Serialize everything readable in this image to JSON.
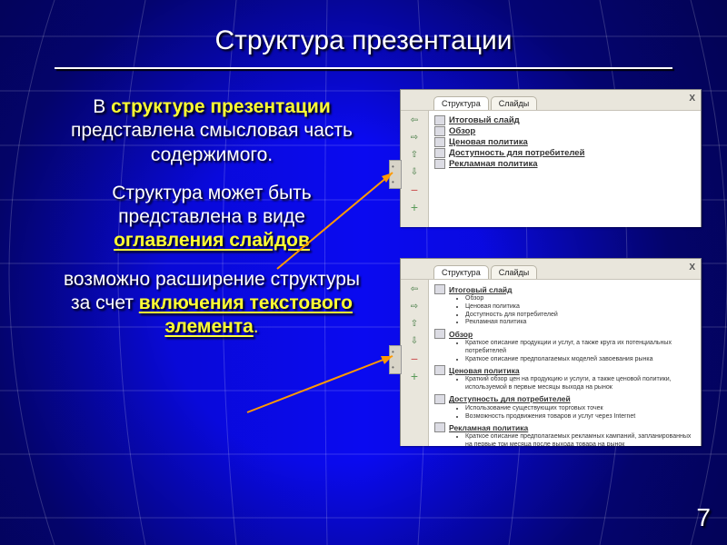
{
  "title": "Структура презентации",
  "body": {
    "p1_a": "В ",
    "p1_hl": "структуре презентации",
    "p1_b": " представлена смысловая часть   содержимого.",
    "p2_a": "Структура может быть представлена в виде ",
    "p2_u": "оглавления слайдов",
    "p3_a": "возможно расширение структуры за счет ",
    "p3_u": "включения текстового элемента",
    "p3_end": "."
  },
  "panel": {
    "tab_struct": "Структура",
    "tab_slides": "Слайды",
    "close": "X"
  },
  "outline1": [
    "Итоговый слайд",
    "Обзор",
    "Ценовая политика",
    "Доступность для потребителей",
    "Рекламная политика"
  ],
  "outline2": [
    {
      "title": "Итоговый слайд",
      "bullets": [
        "Обзор",
        "Ценовая политика",
        "Доступность для потребителей",
        "Рекламная политика"
      ]
    },
    {
      "title": "Обзор",
      "bullets": [
        "Краткое описание продукции и услуг, а также круга их потенциальных потребителей",
        "Краткое описание предполагаемых моделей завоевания рынка"
      ]
    },
    {
      "title": "Ценовая политика",
      "bullets": [
        "Краткий обзор цен на продукцию и услуги, а также ценовой политики, используемой в первые месяцы выхода на рынок"
      ]
    },
    {
      "title": "Доступность для потребителей",
      "bullets": [
        "Использование существующих торговых точек",
        "Возможность продвижения товаров и услуг через Internet"
      ]
    },
    {
      "title": "Рекламная политика",
      "bullets": [
        "Краткое описание предполагаемых рекламных кампаний, запланированных на первые три месяца после выхода товара на рынок"
      ]
    }
  ],
  "pagenum": "7"
}
